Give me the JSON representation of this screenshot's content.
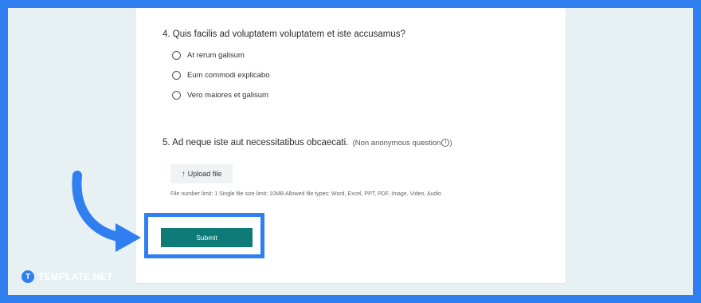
{
  "form": {
    "q4": {
      "title": "4. Quis facilis ad voluptatem voluptatem et iste accusamus?",
      "options": [
        "At rerum galisum",
        "Eum commodi explicabo",
        "Vero maiores et galisum"
      ]
    },
    "q5": {
      "title": "5. Ad neque iste aut necessitatibus obcaecati.",
      "note": "(Non anonymous question",
      "note_close": ")",
      "upload_label": "Upload file",
      "limits_text": "File number limit: 1   Single file size limit: 10MB   Allowed file types: Word, Excel, PPT, PDF, Image, Video, Audio"
    },
    "submit_label": "Submit"
  },
  "branding": {
    "name": "TEMPLATE.NET",
    "mark": "T"
  },
  "colors": {
    "frame_blue": "#2f7ff0",
    "submit_teal": "#0f7b79",
    "background": "#e7f0f3"
  },
  "icons": {
    "upload": "arrow-up-icon",
    "info": "info-circle-icon",
    "pointer": "curved-arrow-icon"
  }
}
